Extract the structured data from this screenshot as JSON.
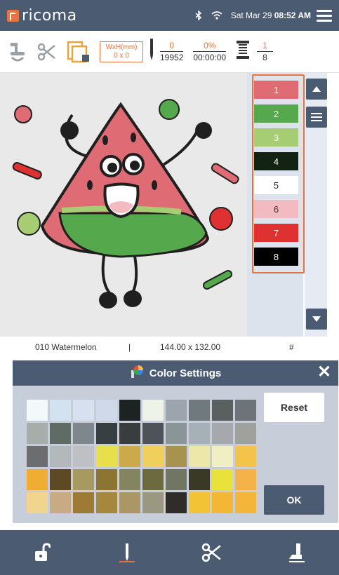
{
  "app": {
    "logo_text": "ricoma"
  },
  "status_bar": {
    "date": "Sat Mar 29",
    "time": "08:52 AM",
    "icons": [
      "bluetooth-icon",
      "wifi-icon",
      "hamburger-menu-icon"
    ]
  },
  "toolbar": {
    "size_label": "WxH(mm)",
    "size_value": "0 x 0",
    "stitch_current": "0",
    "stitch_total": "19952",
    "progress_percent": "0%",
    "progress_time": "00:00:00",
    "color_current": "1",
    "color_total": "8",
    "icons": [
      "machine-icon",
      "trim-icon",
      "hoop-icon",
      "needle-icon",
      "thread-spool-icon"
    ]
  },
  "needle_colors": [
    {
      "label": "1",
      "color": "#e06c73"
    },
    {
      "label": "2",
      "color": "#56a84d"
    },
    {
      "label": "3",
      "color": "#a6cd73"
    },
    {
      "label": "4",
      "color": "#132313"
    },
    {
      "label": "5",
      "color": "#ffffff"
    },
    {
      "label": "6",
      "color": "#f3bbc1"
    },
    {
      "label": "7",
      "color": "#df3131"
    },
    {
      "label": "8",
      "color": "#000000"
    }
  ],
  "design_info": {
    "name": "010 Watermelon",
    "separator": "|",
    "size": "144.00 x 132.00",
    "hash": "#"
  },
  "color_settings": {
    "title": "Color Settings",
    "reset_label": "Reset",
    "ok_label": "OK",
    "palette": [
      "#f3f9fb",
      "#d2e2f1",
      "#d6e0ef",
      "#cfd9e9",
      "#1d2322",
      "#eef3ea",
      "#9ca5ad",
      "#707a7e",
      "#59605f",
      "#6d7379",
      "#a7ada8",
      "#5f6c65",
      "#7e878b",
      "#373f43",
      "#3a3d3e",
      "#4e535a",
      "#8a9598",
      "#a5b1b6",
      "#a5a8ac",
      "#9fa29c",
      "#6c6d6f",
      "#b3b8bb",
      "#bfc0c4",
      "#e9df4c",
      "#ccaa4a",
      "#f0cf5c",
      "#a89250",
      "#ede8a9",
      "#f0efc4",
      "#f2c44a",
      "#efae33",
      "#5d4a25",
      "#a69a60",
      "#8c7433",
      "#858461",
      "#6e6a3f",
      "#717563",
      "#3a3926",
      "#e8e23a",
      "#f4b349",
      "#f1d58e",
      "#c8aa83",
      "#9e7a35",
      "#a5883e",
      "#ab9765",
      "#9a9881",
      "#302c29",
      "#f2c335",
      "#f3b735",
      "#f3b63a"
    ]
  },
  "bottom_nav": {
    "icons": [
      "unlock-icon",
      "needle-icon",
      "trim-icon",
      "presser-foot-icon"
    ]
  }
}
